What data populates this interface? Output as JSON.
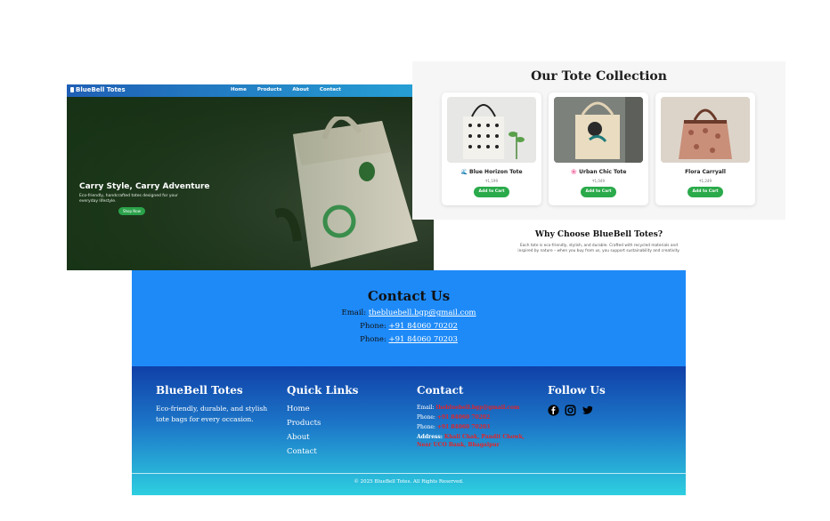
{
  "hero": {
    "brand": "BlueBell Totes",
    "nav": [
      "Home",
      "Products",
      "About",
      "Contact"
    ],
    "title": "Carry Style, Carry Adventure",
    "subtitle": "Eco-friendly, handcrafted totes designed for your everyday lifestyle.",
    "button": "Shop Now"
  },
  "collection": {
    "title": "Our Tote Collection",
    "products": [
      {
        "name": "🌊 Blue Horizon Tote",
        "price": "₹1,199",
        "button": "Add to Cart"
      },
      {
        "name": "🌸 Urban Chic Tote",
        "price": "₹1,049",
        "button": "Add to Cart"
      },
      {
        "name": "Flora Carryall",
        "price": "₹1,249",
        "button": "Add to Cart"
      }
    ]
  },
  "why": {
    "title": "Why Choose BlueBell Totes?",
    "text": "Each tote is eco-friendly, stylish, and durable. Crafted with recycled materials and inspired by nature – when you buy from us, you support sustainability and creativity."
  },
  "contact": {
    "title": "Contact Us",
    "email_label": "Email:",
    "email": "thebluebell.bgp@gmail.com",
    "phone_label": "Phone:",
    "phone1": "+91 84060 70202",
    "phone2": "+91 84060 70203"
  },
  "footer": {
    "brand_title": "BlueBell Totes",
    "brand_text": "Eco-friendly, durable, and stylish tote bags for every occasion.",
    "links_title": "Quick Links",
    "links": [
      "Home",
      "Products",
      "About",
      "Contact"
    ],
    "contact_title": "Contact",
    "email_label": "Email:",
    "email": "thebluebell.bgp@gmail.com",
    "phone_label": "Phone:",
    "phone1": "+91 84060 70202",
    "phone2": "+91 84060 70203",
    "address_label": "Address:",
    "address": "Khali Chak, Pandit Chowk, Near UCO Bank, Bhagalpur",
    "follow_title": "Follow Us",
    "social_icons": [
      "facebook-icon",
      "instagram-icon",
      "twitter-icon"
    ],
    "copyright": "© 2025 BlueBell Totes. All Rights Reserved."
  },
  "colors": {
    "accent_blue": "#1e8af8",
    "green_button": "#2aaa4a",
    "footer_red": "#e0242b"
  }
}
